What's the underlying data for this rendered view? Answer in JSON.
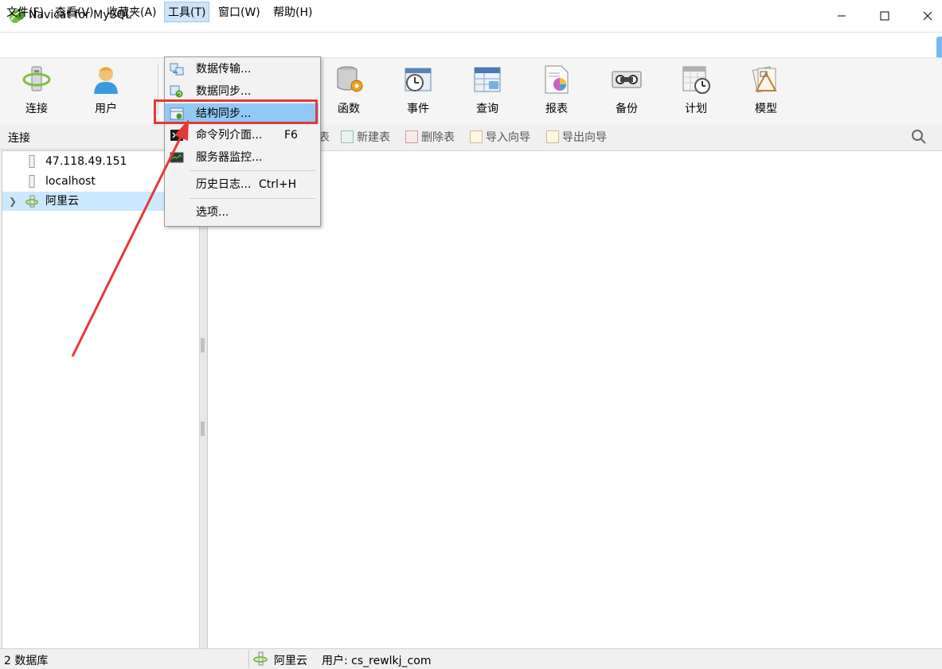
{
  "window": {
    "title": "Navicat for MySQL",
    "minimize_icon": "minimize-icon",
    "maximize_icon": "maximize-icon",
    "close_icon": "close-icon"
  },
  "menubar": {
    "items": [
      {
        "label": "文件(F)"
      },
      {
        "label": "查看(V)"
      },
      {
        "label": "收藏夹(A)"
      },
      {
        "label": "工具(T)"
      },
      {
        "label": "窗口(W)"
      },
      {
        "label": "帮助(H)"
      }
    ],
    "active_index": 3
  },
  "toolbar": {
    "items": [
      {
        "label": "连接",
        "icon": "connection-icon"
      },
      {
        "label": "用户",
        "icon": "user-icon"
      },
      {
        "label": "函数",
        "icon": "function-icon"
      },
      {
        "label": "事件",
        "icon": "event-icon"
      },
      {
        "label": "查询",
        "icon": "query-icon"
      },
      {
        "label": "报表",
        "icon": "report-icon"
      },
      {
        "label": "备份",
        "icon": "backup-icon"
      },
      {
        "label": "计划",
        "icon": "schedule-icon"
      },
      {
        "label": "模型",
        "icon": "model-icon"
      }
    ]
  },
  "left_panel": {
    "header": "连接",
    "tree": [
      {
        "label": "47.118.49.151",
        "icon": "server-icon"
      },
      {
        "label": "localhost",
        "icon": "server-icon"
      },
      {
        "label": "阿里云",
        "icon": "connection-icon",
        "selected": true
      }
    ]
  },
  "sub_toolbar": {
    "items": [
      {
        "label": "表"
      },
      {
        "label": "新建表"
      },
      {
        "label": "删除表"
      },
      {
        "label": "导入向导"
      },
      {
        "label": "导出向导"
      }
    ]
  },
  "tools_menu": {
    "items": [
      {
        "label": "数据传输...",
        "icon": "data-transfer-icon"
      },
      {
        "label": "数据同步...",
        "icon": "data-sync-icon"
      },
      {
        "label": "结构同步...",
        "icon": "structure-sync-icon",
        "highlighted": true
      },
      {
        "label": "命令列介面...",
        "shortcut": "F6",
        "icon": "console-icon"
      },
      {
        "label": "服务器监控...",
        "icon": "server-monitor-icon"
      },
      {
        "label": "历史日志...",
        "shortcut": "Ctrl+H"
      },
      {
        "label": "选项..."
      }
    ]
  },
  "statusbar": {
    "count": "2 数据库",
    "connection": "阿里云",
    "user": "用户: cs_rewlkj_com"
  },
  "annotation": {
    "color": "#e53935"
  }
}
